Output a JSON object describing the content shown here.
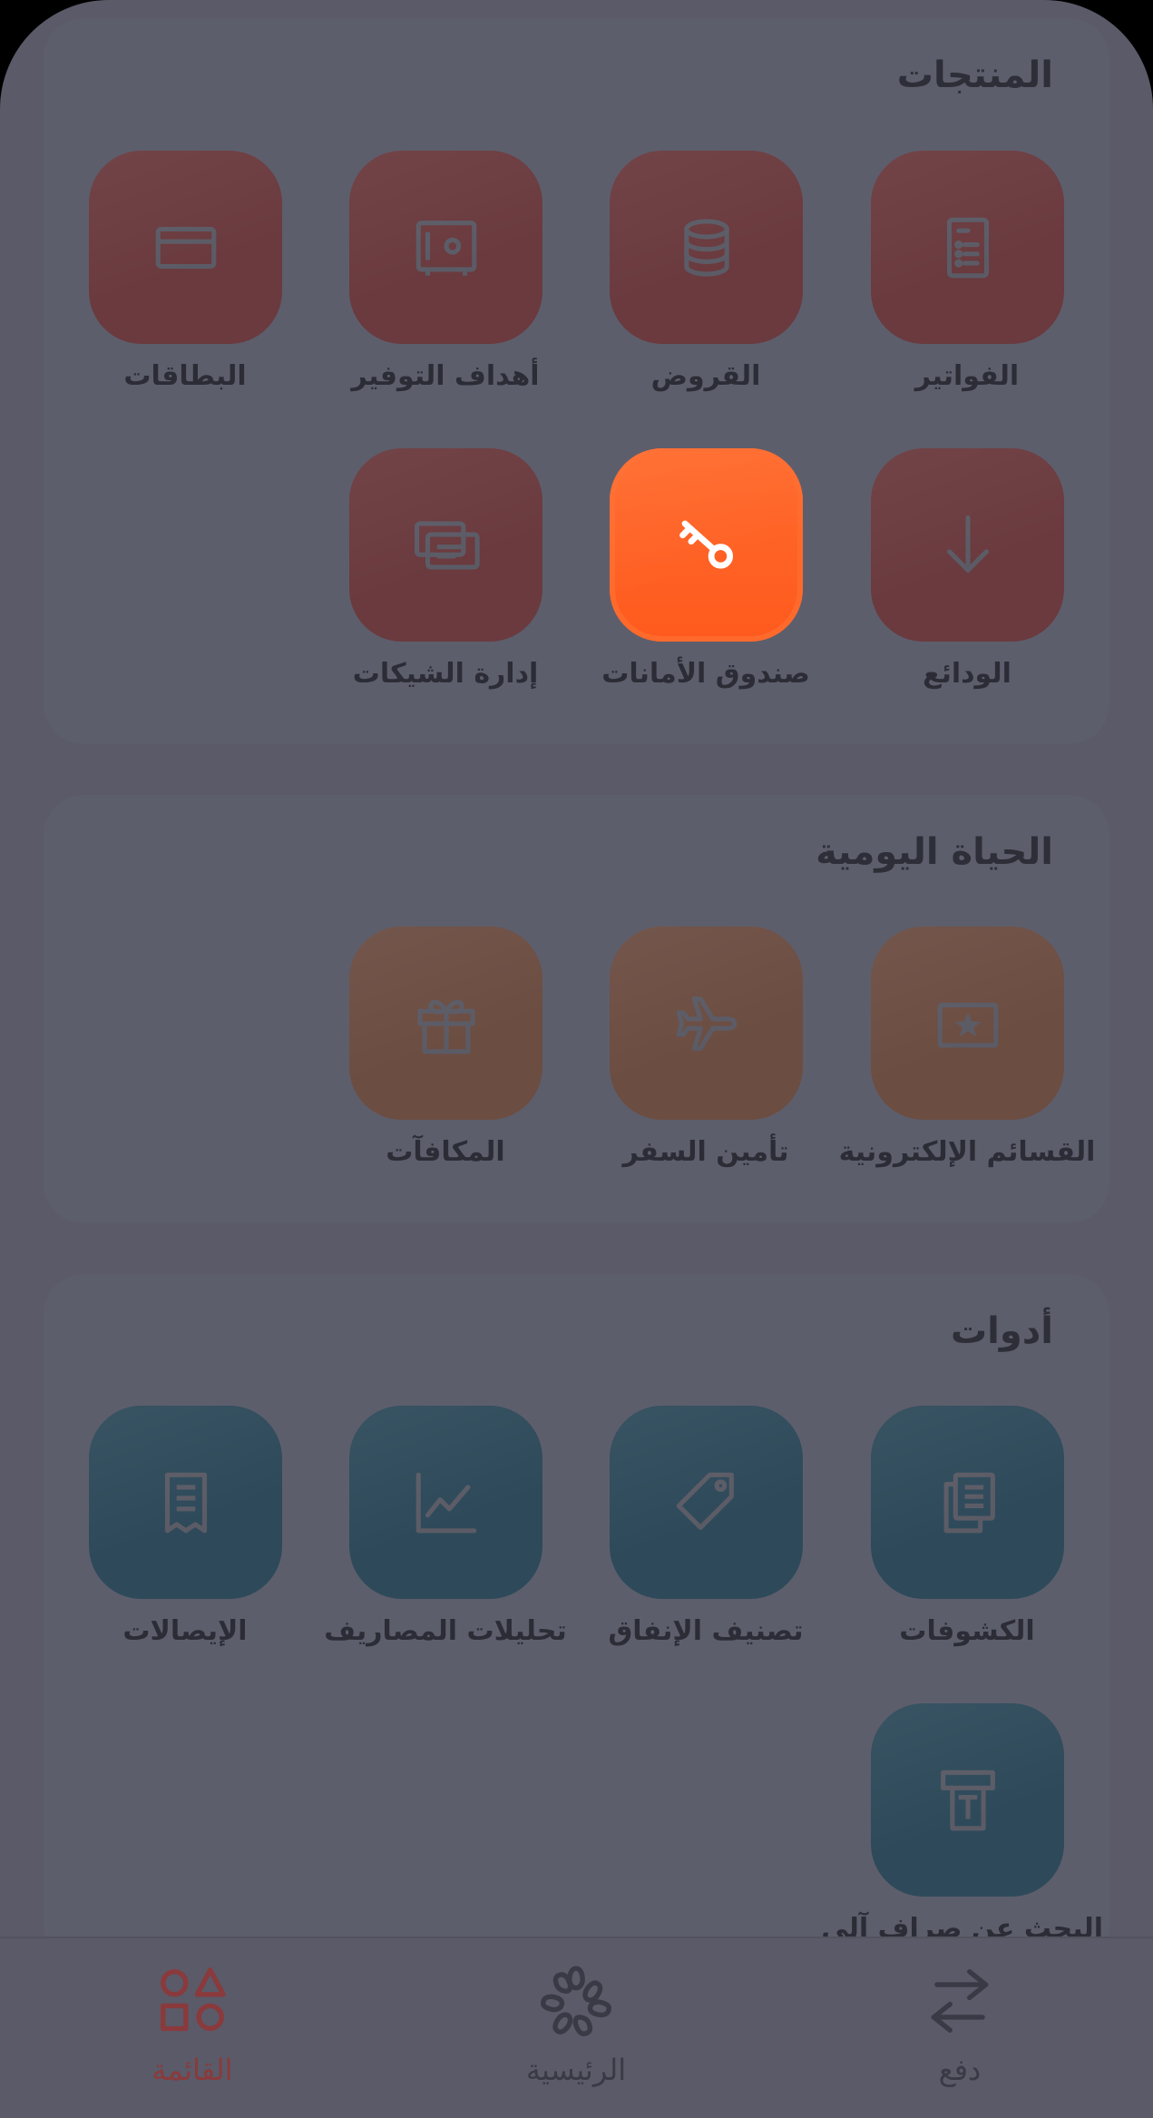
{
  "sections": {
    "products": {
      "title": "المنتجات",
      "items": [
        {
          "label": "الفواتير",
          "icon": "invoice-icon"
        },
        {
          "label": "القروض",
          "icon": "coins-stack-icon"
        },
        {
          "label": "أهداف التوفير",
          "icon": "safe-icon"
        },
        {
          "label": "البطاقات",
          "icon": "card-icon"
        },
        {
          "label": "الودائع",
          "icon": "arrow-down-icon"
        },
        {
          "label": "صندوق الأمانات",
          "icon": "key-icon"
        },
        {
          "label": "إدارة الشيكات",
          "icon": "cheques-icon"
        }
      ]
    },
    "daily_life": {
      "title": "الحياة اليومية",
      "items": [
        {
          "label": "القسائم الإلكترونية",
          "icon": "voucher-icon"
        },
        {
          "label": "تأمين السفر",
          "icon": "airplane-icon"
        },
        {
          "label": "المكافآت",
          "icon": "gift-icon"
        }
      ]
    },
    "tools": {
      "title": "أدوات",
      "items": [
        {
          "label": "الكشوفات",
          "icon": "statements-icon"
        },
        {
          "label": "تصنيف الإنفاق",
          "icon": "tag-icon"
        },
        {
          "label": "تحليلات المصاريف",
          "icon": "line-chart-icon"
        },
        {
          "label": "الإيصالات",
          "icon": "receipt-icon"
        },
        {
          "label": "البحث عن صراف آلي",
          "icon": "atm-icon"
        }
      ]
    }
  },
  "bottom_nav": {
    "pay": "دفع",
    "home": "الرئيسية",
    "menu": "القائمة"
  },
  "colors": {
    "active_tile": "#ff6a2c",
    "products_tile": "#6a3a3e",
    "daily_tile": "#6c4d42",
    "tools_tile": "#2e4a5a",
    "active_nav": "#8a3a3c"
  }
}
